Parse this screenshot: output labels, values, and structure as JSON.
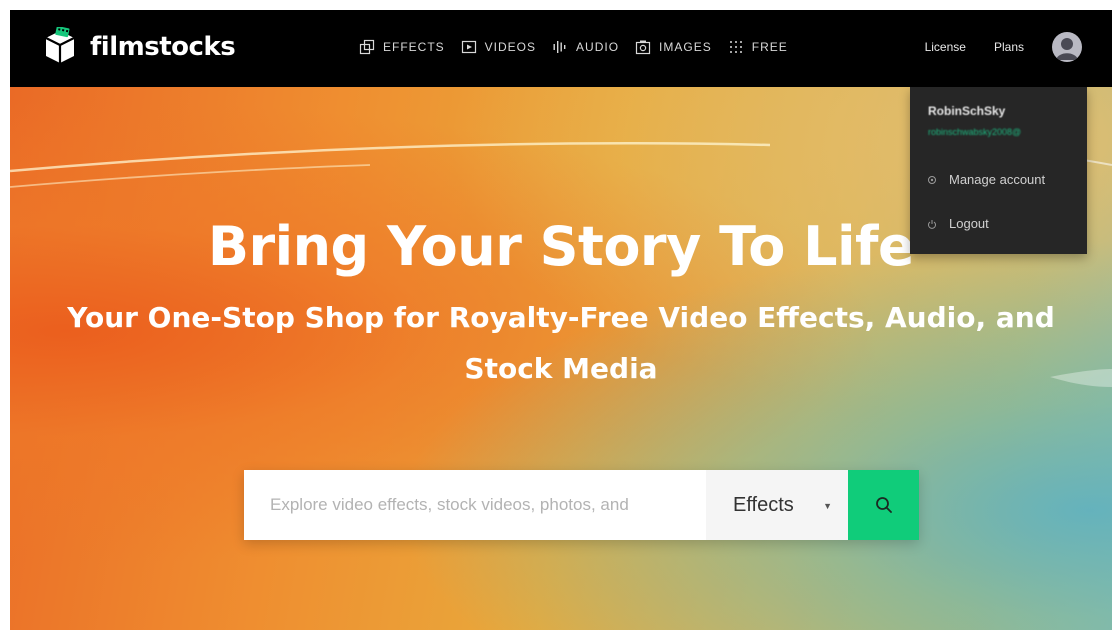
{
  "brand": {
    "name": "filmstocks"
  },
  "nav": {
    "items": [
      {
        "label": "EFFECTS",
        "icon": "effects-icon"
      },
      {
        "label": "VIDEOS",
        "icon": "play-icon"
      },
      {
        "label": "AUDIO",
        "icon": "audio-icon"
      },
      {
        "label": "IMAGES",
        "icon": "image-icon"
      },
      {
        "label": "FREE",
        "icon": "grid-icon"
      }
    ],
    "license": "License",
    "plans": "Plans"
  },
  "hero": {
    "title": "Bring Your Story To Life",
    "subtitle": "Your One-Stop Shop for Royalty-Free Video Effects, Audio, and Stock Media"
  },
  "search": {
    "placeholder": "Explore video effects, stock videos, photos, and",
    "category": "Effects"
  },
  "account_menu": {
    "username": "RobinSchSky",
    "email": "robinschwabsky2008@",
    "items": [
      {
        "label": "Manage account",
        "icon": "settings-icon"
      },
      {
        "label": "Logout",
        "icon": "power-icon"
      }
    ]
  },
  "colors": {
    "navbar": "#000000",
    "accent_green": "#10cc7a",
    "menu_bg": "#262626"
  }
}
